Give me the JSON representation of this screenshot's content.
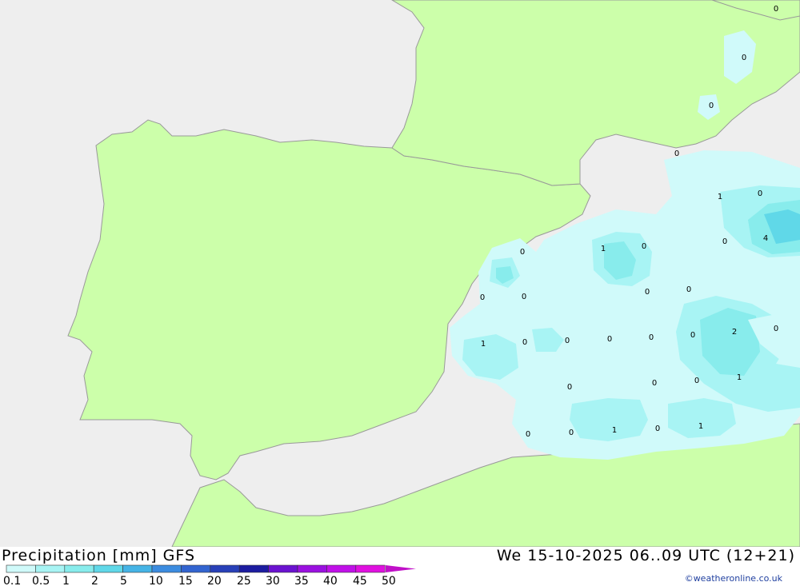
{
  "title": "Precipitation [mm] GFS",
  "time": "We 15-10-2025 06..09 UTC (12+21)",
  "credit": "©weatheronline.co.uk",
  "colors": {
    "sea": "#eeeeee",
    "land": "#ccff aa",
    "border": "#999999"
  },
  "legend": {
    "labels": [
      "0.1",
      "0.5",
      "1",
      "2",
      "5",
      "10",
      "15",
      "20",
      "25",
      "30",
      "35",
      "40",
      "45",
      "50"
    ],
    "colors": [
      "#d0fafa",
      "#a8f4f4",
      "#88ecec",
      "#60d8e8",
      "#46b4e6",
      "#3c8ce0",
      "#3264d0",
      "#2840b8",
      "#1c1ca0",
      "#6a12d0",
      "#9a10e0",
      "#c010e8",
      "#e010e0",
      "#c010c8"
    ]
  },
  "map_values": [
    "0",
    "0",
    "0",
    "0",
    "1",
    "0",
    "4",
    "0",
    "1",
    "0",
    "0",
    "0",
    "0",
    "0",
    "0",
    "2",
    "0",
    "1",
    "0",
    "0",
    "0",
    "0",
    "0",
    "1",
    "0",
    "0",
    "0",
    "0",
    "1",
    "0",
    "1",
    "0"
  ]
}
